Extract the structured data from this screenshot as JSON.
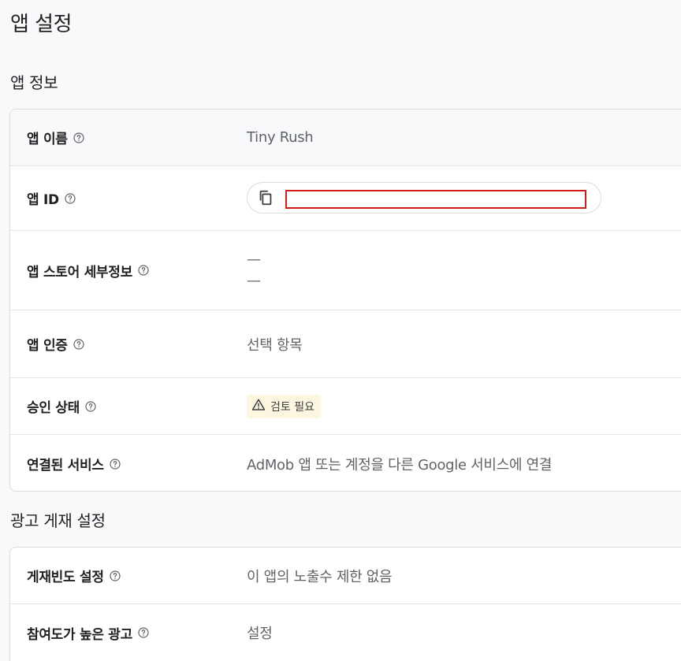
{
  "page": {
    "title": "앱 설정"
  },
  "app_info": {
    "title": "앱 정보",
    "rows": {
      "app_name": {
        "label": "앱 이름",
        "value": "Tiny Rush"
      },
      "app_id": {
        "label": "앱 ID"
      },
      "store_details": {
        "label": "앱 스토어 세부정보",
        "line1": "—",
        "line2": "—"
      },
      "app_verification": {
        "label": "앱 인증",
        "value": "선택 항목"
      },
      "approval_status": {
        "label": "승인 상태",
        "badge": "검토 필요"
      },
      "linked_services": {
        "label": "연결된 서비스",
        "value": "AdMob 앱 또는 계정을 다른 Google 서비스에 연결"
      }
    }
  },
  "ad_serving": {
    "title": "광고 게재 설정",
    "rows": {
      "frequency_cap": {
        "label": "게재빈도 설정",
        "value": "이 앱의 노출수 제한 없음"
      },
      "engaging_ads": {
        "label": "참여도가 높은 광고",
        "value": "설정"
      }
    }
  },
  "colors": {
    "redaction_border": "#d21a1a",
    "badge_background": "#fef7e0",
    "text_secondary": "#5f6368"
  },
  "icons": [
    "help-icon",
    "copy-icon",
    "warning-icon"
  ]
}
